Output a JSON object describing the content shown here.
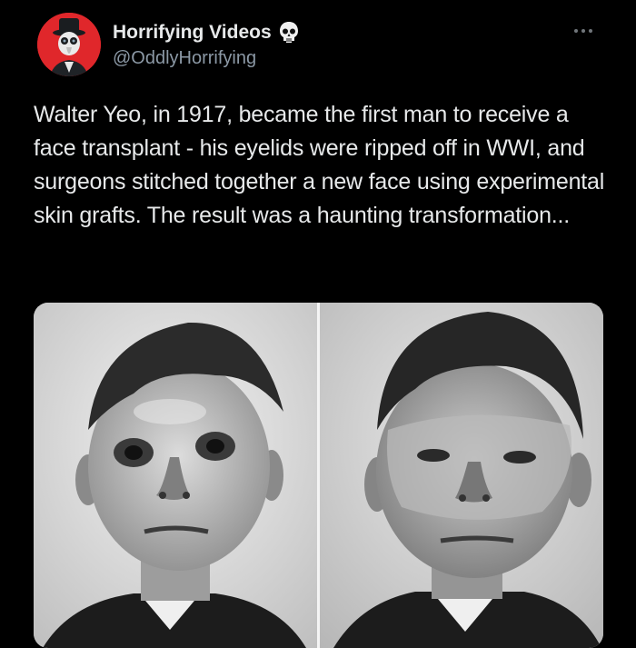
{
  "post": {
    "author": {
      "display_name": "Horrifying Videos",
      "handle": "@OddlyHorrifying",
      "avatar_icon": "plague-doctor-avatar",
      "badge_icon": "skull-icon",
      "avatar_bg": "#e0272b"
    },
    "menu_icon": "more-options-icon",
    "text": "Walter Yeo, in 1917, became the first man to receive a face transplant - his eyelids were ripped off in WWI, and surgeons stitched together a new face using experimental skin grafts. The result was a haunting transformation...",
    "media": {
      "type": "photo",
      "panels": [
        "before-photo",
        "after-photo"
      ]
    }
  },
  "colors": {
    "background": "#000000",
    "primary_text": "#e7e9ea",
    "secondary_text": "#8b98a5"
  }
}
